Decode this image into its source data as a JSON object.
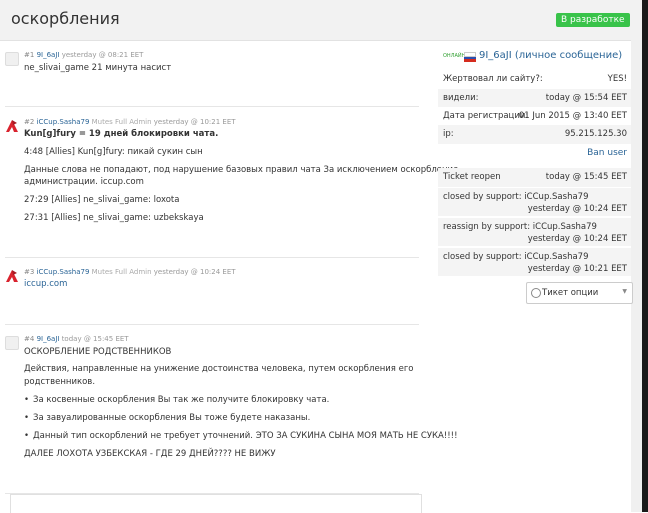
{
  "header": {
    "title": "оскорбления",
    "status": "В разработке"
  },
  "posts": [
    {
      "num": "#1",
      "user": "9I_6aJI",
      "role": "",
      "time": "yesterday @ 08:21 EET",
      "lines": [
        "ne_slivai_game 21 минута насист"
      ]
    },
    {
      "num": "#2",
      "user": "iCCup.Sasha79",
      "role": "Mutes Full Admin",
      "time": "yesterday @ 10:21 EET",
      "lines": [
        "Kun[g]fury = 19 дней блокировки чата.",
        "4:48 [Allies] Kun[g]fury: пикай сукин сын",
        "Данные слова не попадают, под нарушение базовых правил чата За исключением оскорбление",
        "администрации. iccup.com",
        "27:29 [Allies] ne_slivai_game: loxota",
        "27:31 [Allies] ne_slivai_game: uzbekskaya"
      ]
    },
    {
      "num": "#3",
      "user": "iCCup.Sasha79",
      "role": "Mutes Full Admin",
      "time": "yesterday @ 10:24 EET",
      "lines": [
        "iccup.com"
      ]
    },
    {
      "num": "#4",
      "user": "9I_6aJI",
      "role": "",
      "time": "today @ 15:45 EET",
      "lines": [
        "ОСКОРБЛЕНИЕ РОДСТВЕННИКОВ",
        "Действия, направленные на унижение достоинства человека, путем оскорбления его",
        "родственников.",
        "За косвенные оскорбления Вы так же получите блокировку чата.",
        "За завуалированные оскорбления Вы тоже будете наказаны.",
        "Данный тип оскорблений не требует уточнений. ЭТО ЗА СУКИНА СЫНА МОЯ МАТЬ НЕ СУКА!!!!",
        "ДАЛЕЕ ЛОХОТА УЗБЕКСКАЯ - ГДЕ 29 ДНЕЙ???? НЕ ВИЖУ"
      ]
    }
  ],
  "sidebar": {
    "online": "ОНЛАЙН",
    "user": "9I_6aJI (личное сообщение)",
    "info": [
      {
        "label": "Жертвовал ли сайту?:",
        "value": "YES!"
      },
      {
        "label": "видели:",
        "value": "today @ 15:54 EET"
      },
      {
        "label": "Дата регистрации:",
        "value": "01 Jun 2015 @ 13:40 EET"
      },
      {
        "label": "ip:",
        "value": "95.215.125.30"
      }
    ],
    "ban": "Ban user",
    "history": [
      {
        "label": "Ticket reopen",
        "value": "today @ 15:45 EET"
      },
      {
        "label": "closed by support: iCCup.Sasha79",
        "value": "yesterday @ 10:24 EET"
      },
      {
        "label": "reassign by support: iCCup.Sasha79",
        "value": "yesterday @ 10:24 EET"
      },
      {
        "label": "closed by support: iCCup.Sasha79",
        "value": "yesterday @ 10:21 EET"
      }
    ],
    "options": "Тикет опции"
  },
  "colors": {
    "badge": "#39c34a",
    "link": "#2a6496",
    "admin_logo": "#d9232e"
  },
  "icons": {
    "user_avatar": "default-avatar-icon",
    "admin_avatar": "iccup-logo-icon",
    "options": "gear-icon",
    "flag": "russia-flag-icon"
  }
}
